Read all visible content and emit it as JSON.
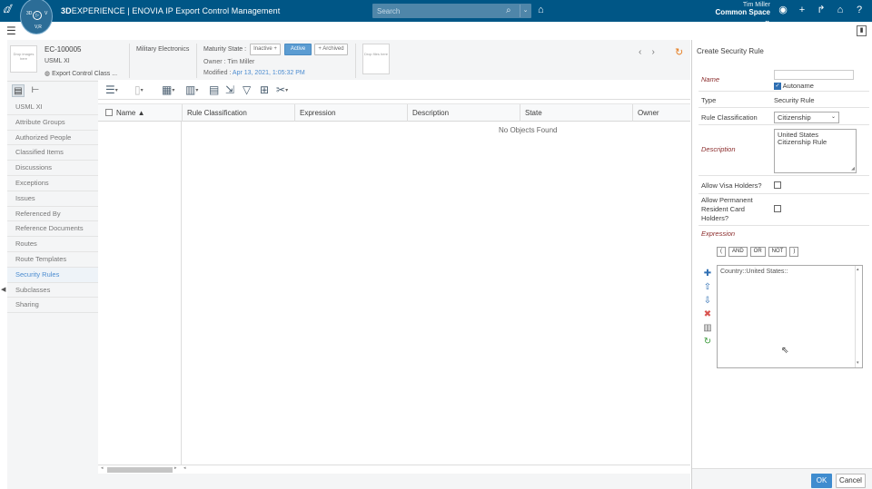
{
  "topbar": {
    "brand_bold": "3D",
    "brand_rest": "EXPERIENCE | ENOVIA",
    "app_name": "IP Export Control Management",
    "search_placeholder": "Search",
    "user_name": "Tim Miller",
    "space": "Common Space",
    "compass": {
      "top_left": "3D",
      "right": "V",
      "bottom": "V,R",
      "center": "▷"
    }
  },
  "object": {
    "drop_images": "Drop images here",
    "id": "EC-100005",
    "type": "USML XI",
    "classification": "Export Control Class ...",
    "category": "Military Electronics",
    "maturity_label": "Maturity State :",
    "states": [
      "Inactive +",
      "Active",
      "+ Archived"
    ],
    "owner": "Owner : Tim Miller",
    "modified_label": "Modified :",
    "modified_date": "Apr 13, 2021, 1:05:32 PM",
    "drop_files": "Drop files here"
  },
  "sidebar": {
    "items": [
      "USML XI",
      "Attribute Groups",
      "Authorized People",
      "Classified Items",
      "Discussions",
      "Exceptions",
      "Issues",
      "Referenced By",
      "Reference Documents",
      "Routes",
      "Route Templates",
      "Security Rules",
      "Subclasses",
      "Sharing"
    ],
    "active_index": 11
  },
  "table": {
    "columns": [
      "Name ▲",
      "Rule Classification",
      "Expression",
      "Description",
      "State",
      "Owner"
    ],
    "empty_message": "No Objects Found"
  },
  "panel": {
    "title": "Create Security Rule",
    "name_label": "Name",
    "name_value": "",
    "autoname_label": "Autoname",
    "autoname_checked": true,
    "type_label": "Type",
    "type_value": "Security Rule",
    "rule_class_label": "Rule Classification",
    "rule_class_value": "Citizenship",
    "description_label": "Description",
    "description_value": "United States Citizenship Rule",
    "visa_label": "Allow Visa Holders?",
    "visa_checked": false,
    "prc_label": "Allow Permanent Resident Card Holders?",
    "prc_checked": false,
    "expression_label": "Expression",
    "operators": [
      "(",
      "AND",
      "OR",
      "NOT",
      ")"
    ],
    "expression_value": "Country::United States::",
    "ok_label": "OK",
    "cancel_label": "Cancel"
  },
  "colors": {
    "topbar": "#005686",
    "accent_blue": "#3f8ccf",
    "active_link": "#4c8cd0",
    "required_label": "#8a2b2b"
  }
}
